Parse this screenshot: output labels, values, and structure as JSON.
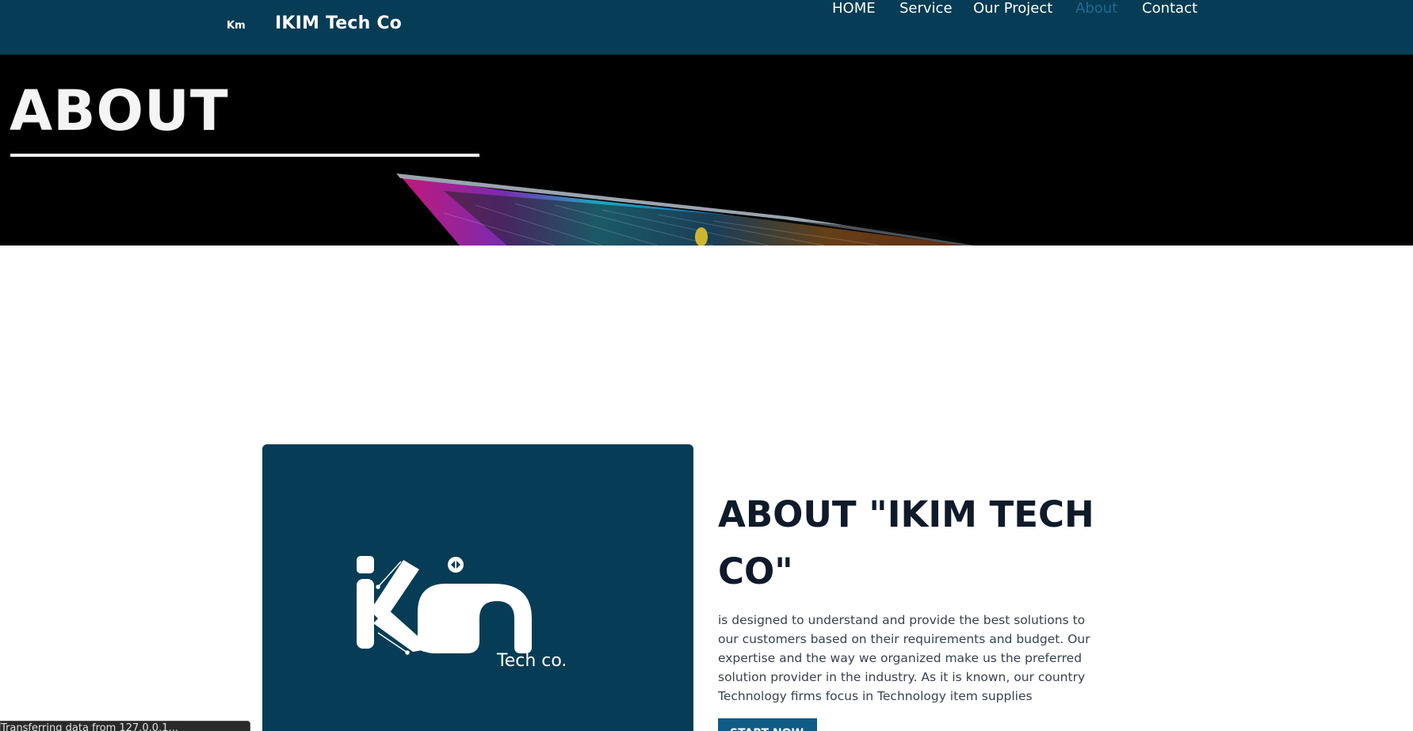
{
  "navbar": {
    "brand_logo_icon": "ikim-logo-icon",
    "brand_name": "IKIM Tech Co",
    "items": [
      {
        "label": "HOME",
        "active": false
      },
      {
        "label": "Service",
        "active": false
      },
      {
        "label": "Our Project",
        "active": false
      },
      {
        "label": "About",
        "active": true
      },
      {
        "label": "Contact",
        "active": false
      }
    ],
    "colors": {
      "background": "#063c55",
      "active": "#1e6a97"
    }
  },
  "hero": {
    "title": "ABOUT",
    "background": "#000000"
  },
  "about": {
    "heading": "ABOUT \"IKIM TECH CO\"",
    "text": "is designed to understand and provide the best solutions to our customers based on their requirements and budget. Our expertise and the way we organized make us the preferred solution provider in the industry. As it is known, our country Technology firms focus in Technology item supplies",
    "cta_label": "START NOW",
    "logo_caption": "Tech co.",
    "colors": {
      "card": "#063c55",
      "cta": "#0f5b86"
    }
  },
  "status_bar": {
    "text": "Transferring data from 127.0.0.1..."
  }
}
